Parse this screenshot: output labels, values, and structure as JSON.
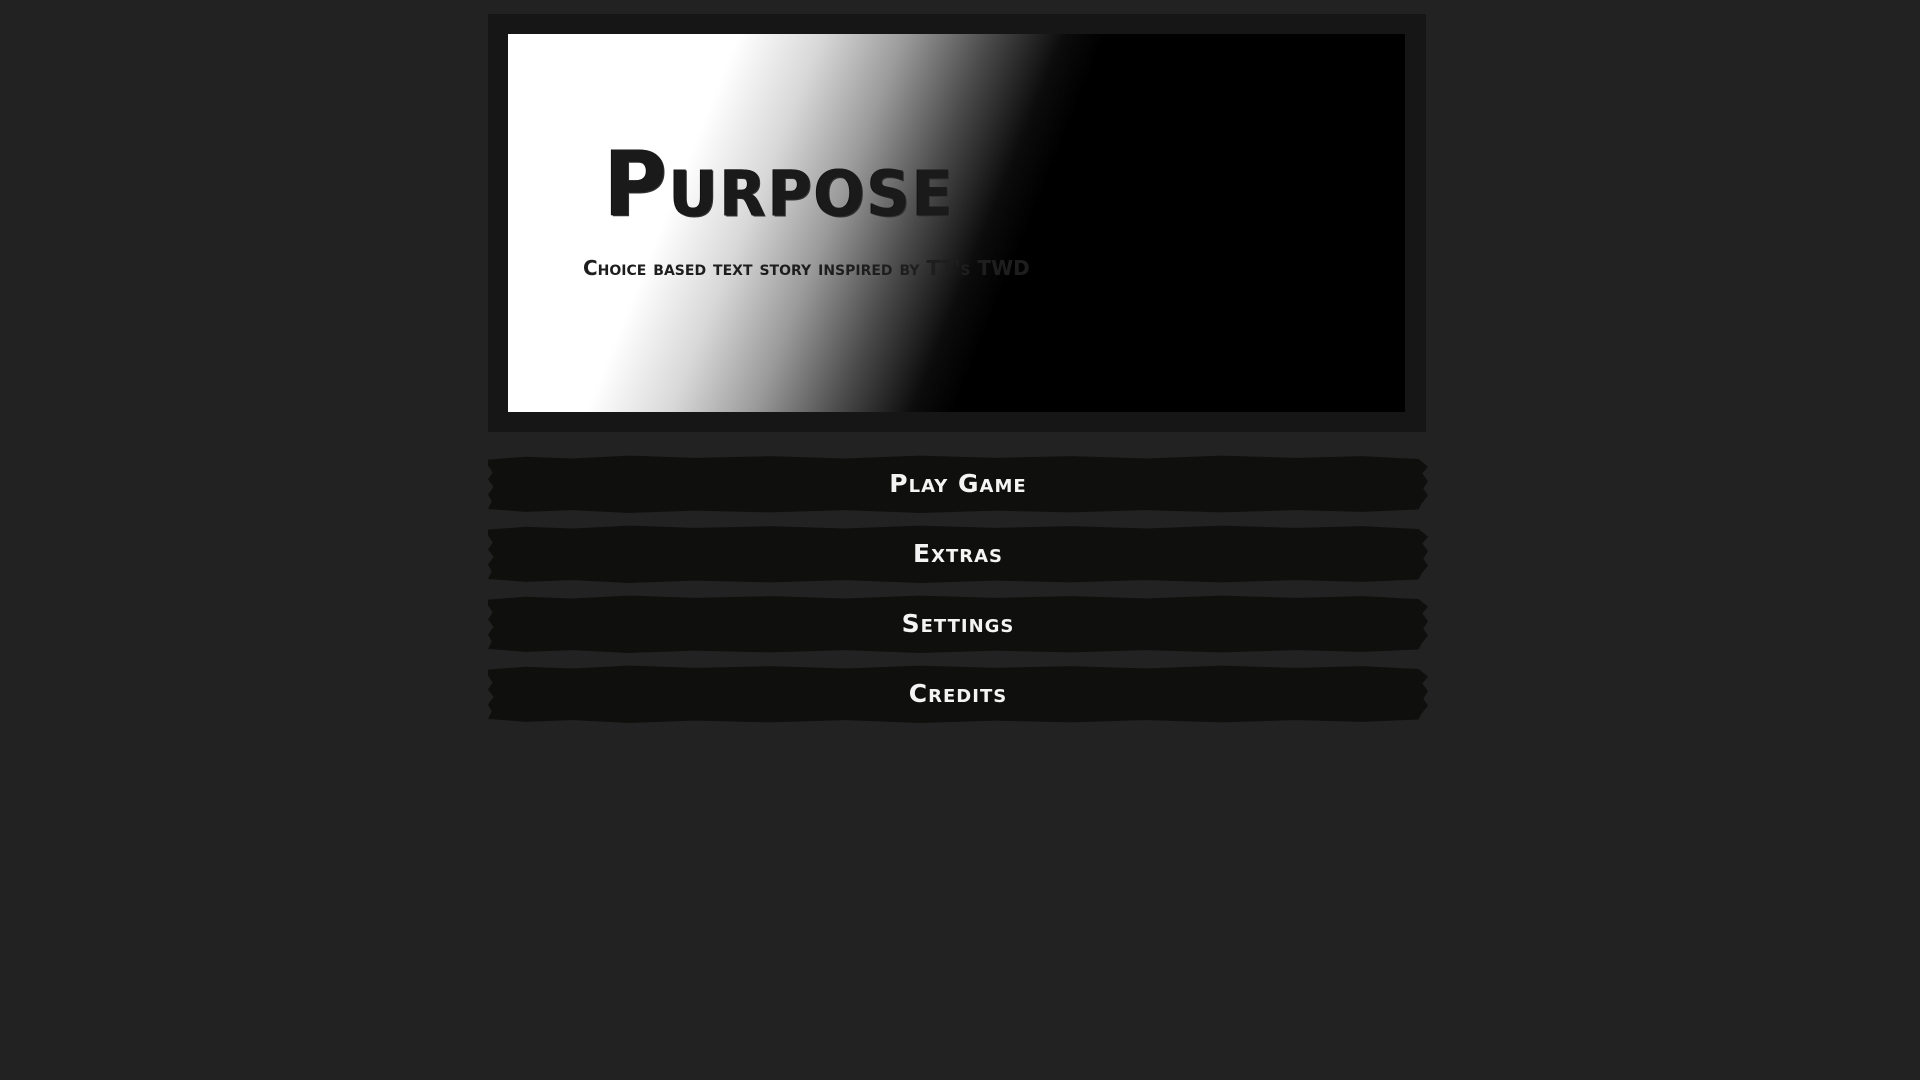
{
  "banner": {
    "title": "Purpose",
    "subtitle": "Choice based text story inspired by TT's TWD"
  },
  "menu": {
    "items": [
      {
        "label": "Play Game"
      },
      {
        "label": "Extras"
      },
      {
        "label": "Settings"
      },
      {
        "label": "Credits"
      }
    ]
  },
  "colors": {
    "background": "#222222",
    "frame": "#161616",
    "button": "#0f100e",
    "button_text": "#f4f4f4"
  }
}
